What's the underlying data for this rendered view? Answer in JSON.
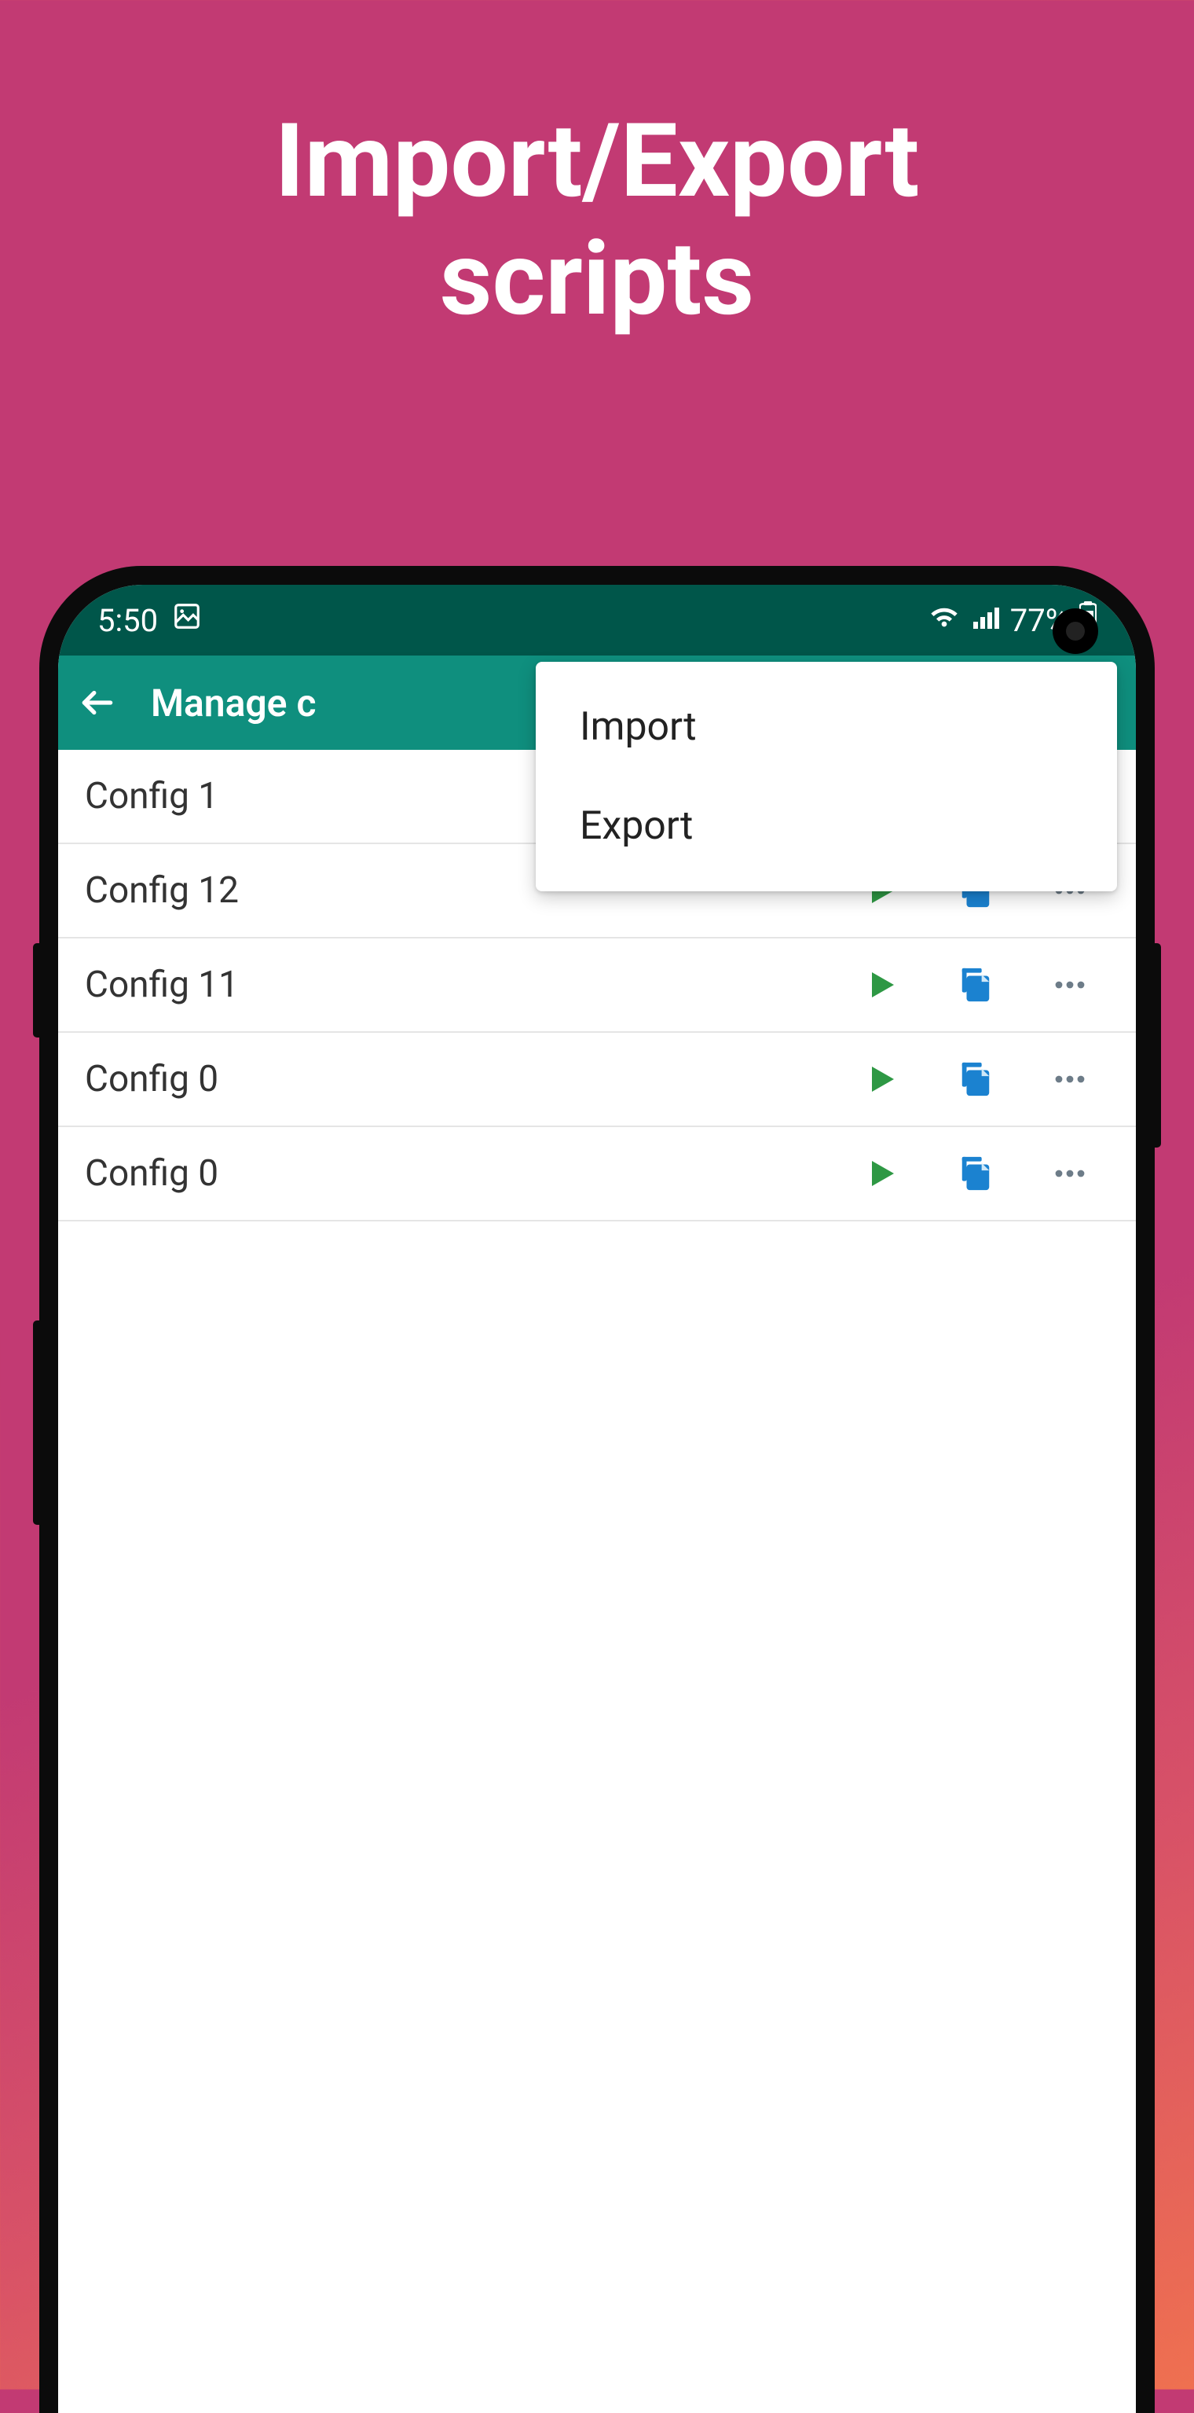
{
  "promo": {
    "title_line1": "Import/Export",
    "title_line2": "scripts"
  },
  "status_bar": {
    "time": "5:50",
    "battery_pct": "77%"
  },
  "app_bar": {
    "title": "Manage c"
  },
  "popup": {
    "items": [
      "Import",
      "Export"
    ]
  },
  "configs": [
    {
      "name": "Config 1"
    },
    {
      "name": "Config 12"
    },
    {
      "name": "Config 11"
    },
    {
      "name": "Config 0"
    },
    {
      "name": "Config 0"
    }
  ],
  "colors": {
    "status_bar_bg": "#00564a",
    "app_bar_bg": "#0f8f7e",
    "play_green": "#2e9844",
    "copy_blue": "#1b82d0",
    "more_gray": "#6d7c88"
  }
}
